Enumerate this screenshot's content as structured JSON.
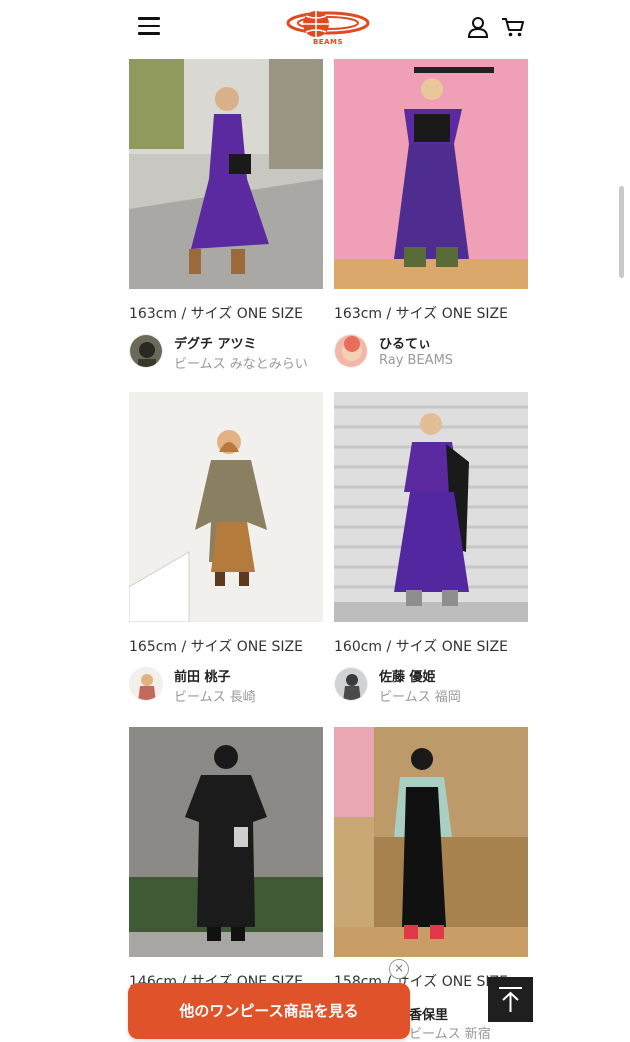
{
  "header": {
    "logo_text": "BEAMS",
    "icons": [
      "menu-icon",
      "account-icon",
      "cart-icon"
    ]
  },
  "colors": {
    "accent": "#e0522a",
    "logo": "#e04a1f",
    "muted_text": "#999999"
  },
  "styling_cards": [
    {
      "height": "163cm / サイズ ONE SIZE",
      "name": "デグチ アツミ",
      "shop": "ビームス みなとみらい"
    },
    {
      "height": "163cm / サイズ ONE SIZE",
      "name": "ひるてぃ",
      "shop": "Ray BEAMS"
    },
    {
      "height": "165cm / サイズ ONE SIZE",
      "name": "前田 桃子",
      "shop": "ビームス 長崎"
    },
    {
      "height": "160cm / サイズ ONE SIZE",
      "name": "佐藤 優姫",
      "shop": "ビームス 福岡"
    },
    {
      "height": "146cm / サイズ ONE SIZE",
      "name": "",
      "shop": ""
    },
    {
      "height": "158cm / サイズ ONE SIZE",
      "name": "香保里",
      "shop": "ビームス 新宿"
    }
  ],
  "cta": {
    "label": "他のワンピース商品を見る",
    "close_label": "×"
  },
  "scroll_top_label": "page-top"
}
